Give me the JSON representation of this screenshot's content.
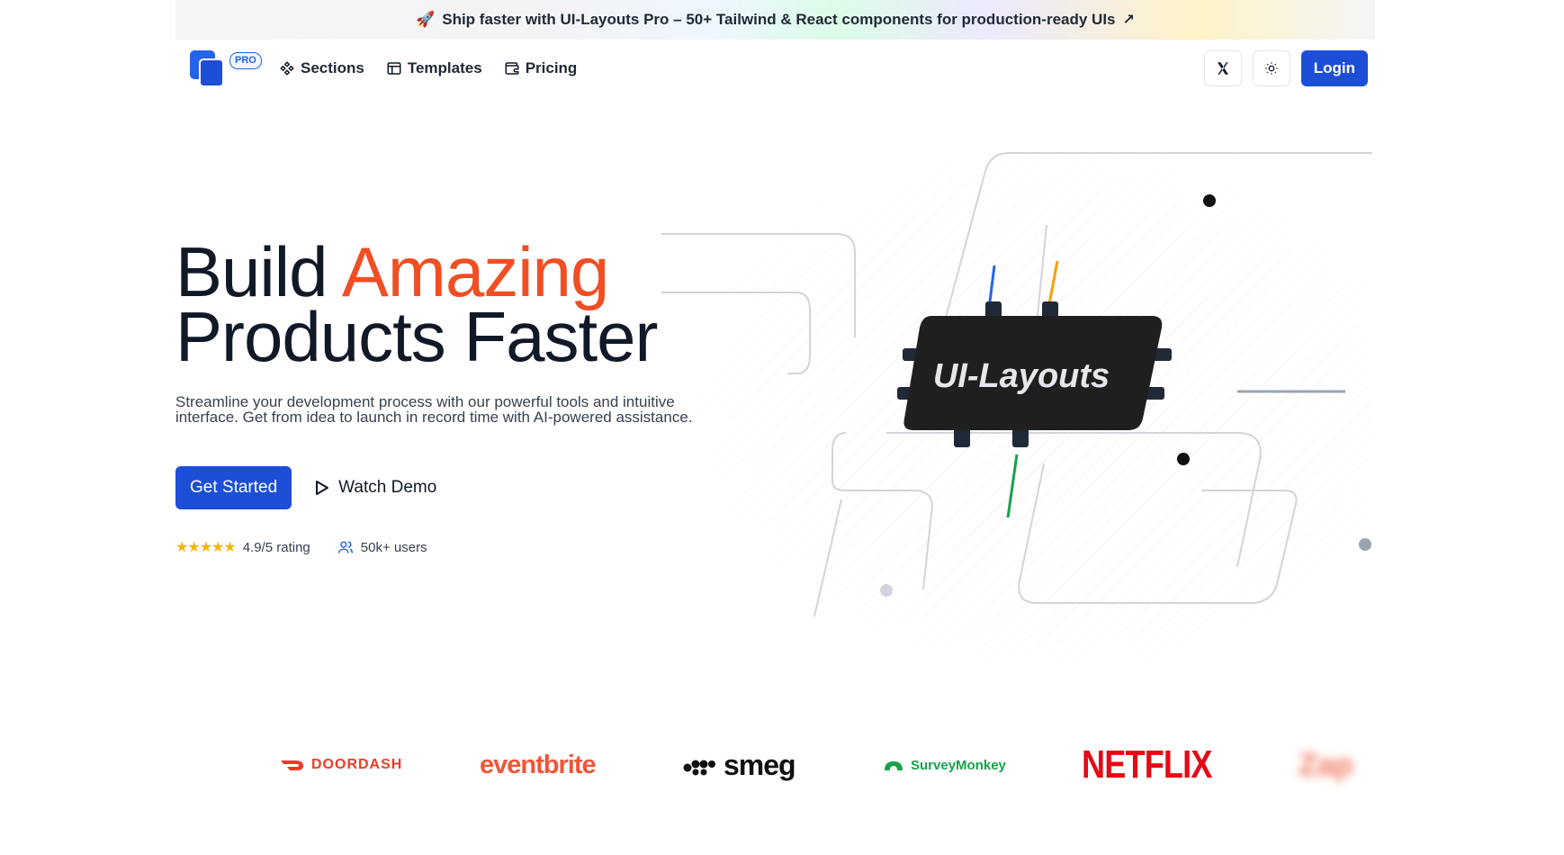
{
  "banner": {
    "emoji": "🚀",
    "text": "Ship faster with UI-Layouts Pro – 50+ Tailwind & React components for production-ready UIs",
    "arrow": "↗"
  },
  "nav": {
    "pro_badge": "PRO",
    "links": [
      {
        "label": "Sections",
        "icon": "sections-icon"
      },
      {
        "label": "Templates",
        "icon": "templates-icon"
      },
      {
        "label": "Pricing",
        "icon": "wallet-icon"
      }
    ],
    "x_icon": "x-logo-icon",
    "theme_icon": "sun-icon",
    "login_label": "Login"
  },
  "hero": {
    "title_part1": "Build ",
    "title_accent": "Amazing",
    "title_line2": "Products Faster",
    "subtitle": "Streamline your development process with our powerful tools and intuitive interface. Get from idea to launch in record time with AI-powered assistance.",
    "cta_primary": "Get Started",
    "cta_secondary": "Watch Demo",
    "stars": "★★★★★",
    "rating": "4.9/5 rating",
    "users": "50k+ users",
    "chip_label": "UI-Layouts"
  },
  "logos": {
    "doordash": "DOORDASH",
    "eventbrite": "eventbrite",
    "smeg": "smeg",
    "surveymonkey": "SurveyMonkey",
    "netflix": "NETFLIX",
    "blurred": "Zap"
  },
  "colors": {
    "primary": "#1d4ed8",
    "accent": "#f04e23",
    "text": "#111827"
  }
}
